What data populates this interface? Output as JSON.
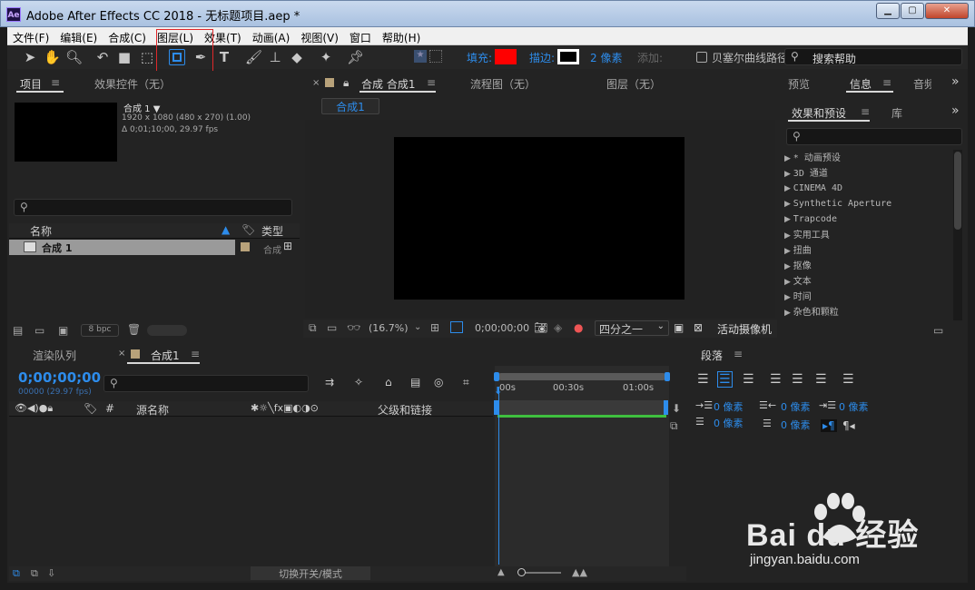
{
  "window": {
    "title": "Adobe After Effects CC 2018 - 无标题项目.aep *",
    "app_badge": "Ae"
  },
  "menu": [
    "文件(F)",
    "编辑(E)",
    "合成(C)",
    "图层(L)",
    "效果(T)",
    "动画(A)",
    "视图(V)",
    "窗口",
    "帮助(H)"
  ],
  "toolbar": {
    "fill_label": "填充:",
    "stroke_label": "描边:",
    "stroke_width": "2 像素",
    "add_label": "添加:",
    "bezier_label": "贝塞尔曲线路径",
    "search_help": "搜索帮助"
  },
  "project": {
    "tab_project": "项目",
    "tab_effects": "效果控件（无）",
    "comp_name": "合成 1 ▼",
    "comp_info": "1920 x 1080 (480 x 270) (1.00)",
    "comp_duration": "Δ 0;01;10;00, 29.97 fps",
    "col_name": "名称",
    "col_type": "类型",
    "item_name": "合成 1",
    "item_type": "合成",
    "bpc": "8 bpc"
  },
  "viewer": {
    "tab_comp": "合成 合成1",
    "tab_flow": "流程图（无）",
    "tab_layer": "图层（无）",
    "sub_tab": "合成1",
    "zoom": "(16.7%)",
    "timecode": "0;00;00;00",
    "resolution": "四分之一",
    "camera": "活动摄像机"
  },
  "right": {
    "tab_preview": "预览",
    "tab_info": "信息",
    "tab_audio": "音频",
    "tab_effects_presets": "效果和预设",
    "tab_library": "库",
    "effects": [
      "* 动画预设",
      "3D 通道",
      "CINEMA 4D",
      "Synthetic Aperture",
      "Trapcode",
      "实用工具",
      "扭曲",
      "抠像",
      "文本",
      "时间",
      "杂色和颗粒"
    ]
  },
  "timeline": {
    "tab_render": "渲染队列",
    "tab_comp": "合成1",
    "timecode": "0;00;00;00",
    "frames": "00000 (29.97 fps)",
    "col_source": "源名称",
    "col_parent": "父级和链接",
    "ruler": [
      "00s",
      "00:30s",
      "01:00s"
    ],
    "toggle_label": "切换开关/模式"
  },
  "paragraph": {
    "title": "段落",
    "px1": "0 像素",
    "px2": "0 像素",
    "px3": "0 像素",
    "px4": "0 像素",
    "px5": "0 像素"
  },
  "watermark": {
    "brand": "Bai du 经验",
    "url": "jingyan.baidu.com"
  },
  "colors": {
    "fill": "#ff0000",
    "accent": "#2d8ceb",
    "highlight_box": "#e0282a"
  }
}
